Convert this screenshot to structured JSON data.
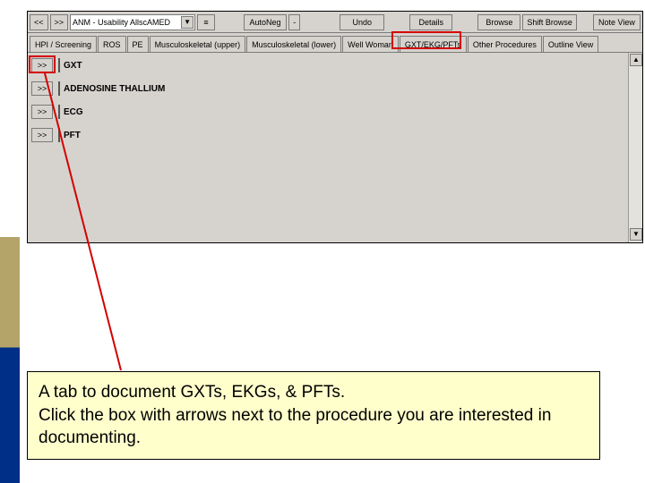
{
  "toolbar": {
    "nav_back": "<<",
    "nav_fwd": ">>",
    "template_selector": "ANM - Usability AllscAMED",
    "separator_btn": "≡",
    "autoneg": "AutoNeg",
    "undo": "Undo",
    "details": "Details",
    "browse": "Browse",
    "shift_browse": "Shift Browse",
    "note_view": "Note View"
  },
  "tabs": [
    "HPI / Screening",
    "ROS",
    "PE",
    "Musculoskeletal (upper)",
    "Musculoskeletal (lower)",
    "Well Woman",
    "GXT/EKG/PFTs",
    "Other Procedures",
    "Outline View"
  ],
  "active_tab_index": 6,
  "procedures": [
    "GXT",
    "ADENOSINE THALLIUM",
    "ECG",
    "PFT"
  ],
  "expand_glyph": ">>",
  "callout": {
    "line1": "A tab to document GXTs, EKGs, & PFTs.",
    "line2": "Click the box with arrows next to the procedure you are interested in documenting."
  }
}
